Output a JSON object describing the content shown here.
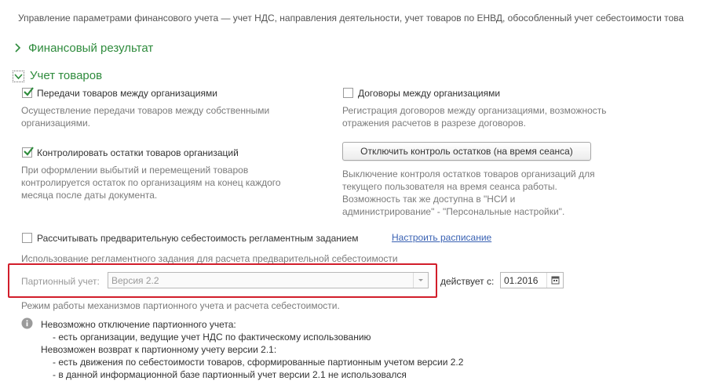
{
  "header": {
    "description": "Управление параметрами финансового учета — учет НДС, направления деятельности, учет товаров по ЕНВД, обособленный учет себестоимости това"
  },
  "sections": {
    "financial_result": {
      "title": "Финансовый результат",
      "expanded": false
    },
    "goods_accounting": {
      "title": "Учет товаров",
      "expanded": true
    }
  },
  "options": {
    "transfer_between_orgs": {
      "label": "Передачи товаров между организациями",
      "checked": true,
      "hint_line1": "Осуществление передачи товаров между собственными",
      "hint_line2": "организациями."
    },
    "contracts_between_orgs": {
      "label": "Договоры между организациями",
      "checked": false,
      "hint_line1": "Регистрация договоров между организациями, возможность",
      "hint_line2": "отражения расчетов  в разрезе договоров."
    },
    "control_stock": {
      "label": "Контролировать остатки товаров организаций",
      "checked": true,
      "hint_line1": "При оформлении выбытий и перемещений товаров",
      "hint_line2": "контролируется остаток по организациям на конец каждого",
      "hint_line3": "месяца после даты документа."
    },
    "disable_stock_control": {
      "button_label": "Отключить контроль остатков (на время сеанса)",
      "hint_line1": "Выключение контроля остатков товаров организаций для",
      "hint_line2": "текущего пользователя на время сеанса работы.",
      "hint_line3": "Возможность так же доступна в \"НСИ и",
      "hint_line4": "администрирование\" - \"Персональные настройки\"."
    },
    "preliminary_cost": {
      "label": "Рассчитывать предварительную себестоимость регламентным заданием",
      "checked": false,
      "link": "Настроить расписание",
      "hint": "Использование регламентного задания для расчета предварительной себестоимости"
    }
  },
  "batch_accounting": {
    "label": "Партионный учет:",
    "value": "Версия 2.2",
    "effective_label": "действует с:",
    "effective_date": "01.2016",
    "hint": "Режим работы механизмов партионного учета и расчета себестоимости."
  },
  "info": {
    "line1": "Невозможно отключение партионного учета:",
    "line2": "- есть организации, ведущие учет НДС по фактическому использованию",
    "line3": "Невозможен возврат к партионному учету версии 2.1:",
    "line4": "- есть движения по себестоимости товаров, сформированные партионным учетом версии 2.2",
    "line5": "- в данной информационной базе партионный учет версии 2.1 не использовался"
  },
  "colors": {
    "accent_green": "#2e8b3c",
    "highlight_red": "#d21e2b",
    "link_blue": "#3a62b3",
    "hint_gray": "#7b7b7b"
  }
}
